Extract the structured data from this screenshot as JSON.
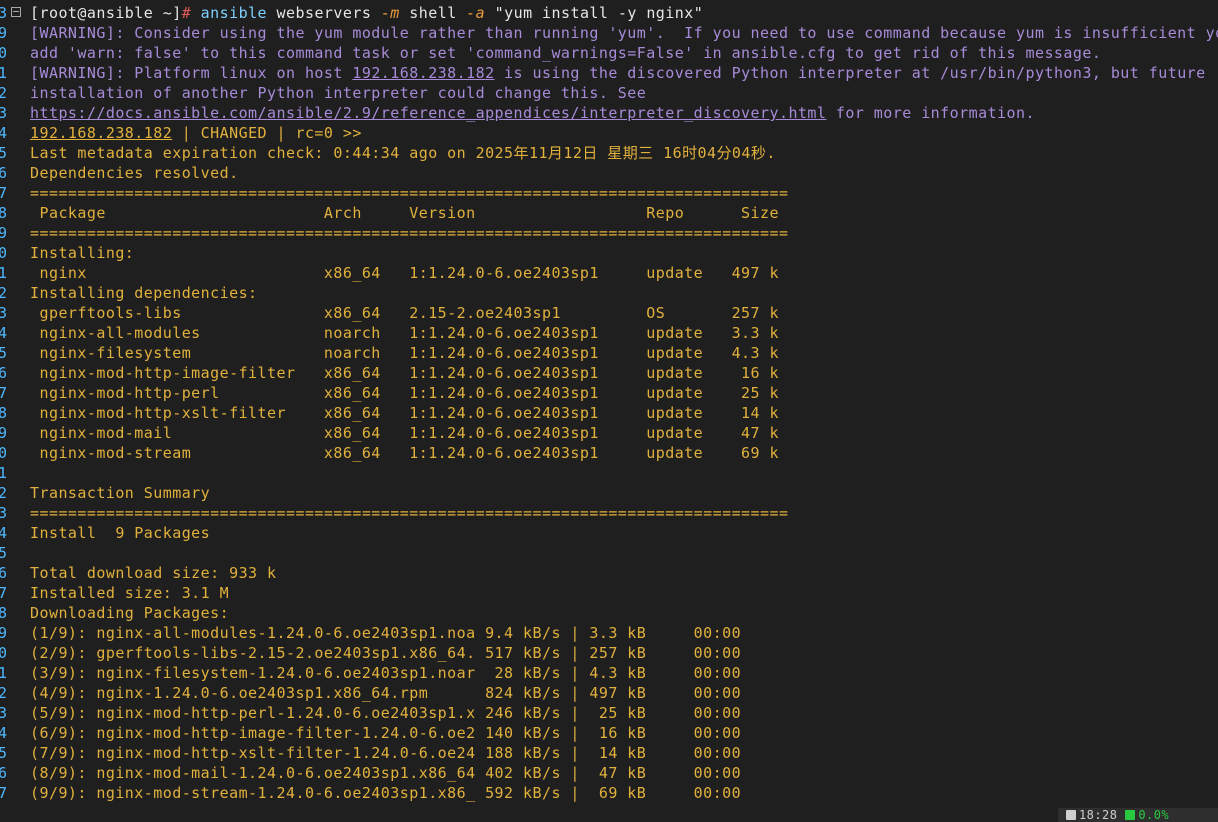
{
  "gutter": [
    "3",
    "9",
    "0",
    "1",
    "2",
    "3",
    "4",
    "5",
    "6",
    "7",
    "8",
    "9",
    "0",
    "1",
    "2",
    "3",
    "4",
    "5",
    "6",
    "7",
    "8",
    "9",
    "0",
    "1",
    "2",
    "3",
    "4",
    "5",
    "6",
    "7",
    "8",
    "9",
    "0",
    "1",
    "2",
    "3",
    "4",
    "5",
    "6",
    "7"
  ],
  "prompt": {
    "user_host": "[root@ansible ~]",
    "hash": "#",
    "cmd": "ansible",
    "group": "webservers",
    "flag_m": "-m",
    "module": "shell",
    "flag_a": "-a",
    "args": "\"yum install -y nginx\""
  },
  "warnings": {
    "line1": "[WARNING]: Consider using the yum module rather than running 'yum'.  If you need to use command because yum is insufficient you can",
    "line2": "add 'warn: false' to this command task or set 'command_warnings=False' in ansible.cfg to get rid of this message.",
    "line3_pre": "[WARNING]: Platform linux on host ",
    "host": "192.168.238.182",
    "line3_post": " is using the discovered Python interpreter at /usr/bin/python3, but future",
    "line4": "installation of another Python interpreter could change this. See",
    "url": "https://docs.ansible.com/ansible/2.9/reference_appendices/interpreter_discovery.html",
    "line5_post": " for more information."
  },
  "result": {
    "host": "192.168.238.182",
    "status": " | CHANGED | rc=0 >>"
  },
  "output": [
    "Last metadata expiration check: 0:44:34 ago on 2025年11月12日 星期三 16时04分04秒.",
    "Dependencies resolved.",
    "================================================================================",
    " Package                       Arch     Version                  Repo      Size",
    "================================================================================",
    "Installing:",
    " nginx                         x86_64   1:1.24.0-6.oe2403sp1     update   497 k",
    "Installing dependencies:",
    " gperftools-libs               x86_64   2.15-2.oe2403sp1         OS       257 k",
    " nginx-all-modules             noarch   1:1.24.0-6.oe2403sp1     update   3.3 k",
    " nginx-filesystem              noarch   1:1.24.0-6.oe2403sp1     update   4.3 k",
    " nginx-mod-http-image-filter   x86_64   1:1.24.0-6.oe2403sp1     update    16 k",
    " nginx-mod-http-perl           x86_64   1:1.24.0-6.oe2403sp1     update    25 k",
    " nginx-mod-http-xslt-filter    x86_64   1:1.24.0-6.oe2403sp1     update    14 k",
    " nginx-mod-mail                x86_64   1:1.24.0-6.oe2403sp1     update    47 k",
    " nginx-mod-stream              x86_64   1:1.24.0-6.oe2403sp1     update    69 k",
    "",
    "Transaction Summary",
    "================================================================================",
    "Install  9 Packages",
    "",
    "Total download size: 933 k",
    "Installed size: 3.1 M",
    "Downloading Packages:",
    "(1/9): nginx-all-modules-1.24.0-6.oe2403sp1.noa 9.4 kB/s | 3.3 kB     00:00",
    "(2/9): gperftools-libs-2.15-2.oe2403sp1.x86_64. 517 kB/s | 257 kB     00:00",
    "(3/9): nginx-filesystem-1.24.0-6.oe2403sp1.noar  28 kB/s | 4.3 kB     00:00",
    "(4/9): nginx-1.24.0-6.oe2403sp1.x86_64.rpm      824 kB/s | 497 kB     00:00",
    "(5/9): nginx-mod-http-perl-1.24.0-6.oe2403sp1.x 246 kB/s |  25 kB     00:00",
    "(6/9): nginx-mod-http-image-filter-1.24.0-6.oe2 140 kB/s |  16 kB     00:00",
    "(7/9): nginx-mod-http-xslt-filter-1.24.0-6.oe24 188 kB/s |  14 kB     00:00",
    "(8/9): nginx-mod-mail-1.24.0-6.oe2403sp1.x86_64 402 kB/s |  47 kB     00:00",
    "(9/9): nginx-mod-stream-1.24.0-6.oe2403sp1.x86_ 592 kB/s |  69 kB     00:00"
  ],
  "status_bar": {
    "clock_icon": "clock-icon",
    "time": "18:28",
    "cpu_icon": "cpu-icon",
    "cpu": "0.0%"
  },
  "colors": {
    "background": "#1f1f1f",
    "warning": "#a78bd8",
    "output": "#e2b13c",
    "prompt_hash": "#e05a5a",
    "command": "#7fd0ff",
    "flag": "#e89a3c"
  }
}
